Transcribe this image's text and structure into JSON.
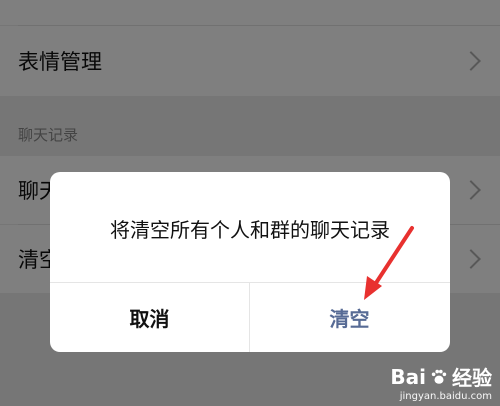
{
  "settings": {
    "sticker_label": "表情管理",
    "section_label": "聊天记录",
    "chat_row_partial": "聊天",
    "clear_row_partial": "清空"
  },
  "dialog": {
    "message": "将清空所有个人和群的聊天记录",
    "cancel_label": "取消",
    "confirm_label": "清空",
    "confirm_color": "#576b95"
  },
  "watermark": {
    "brand": "Bai",
    "brand_suffix": "经验",
    "url": "jingyan.baidu.com"
  },
  "annotation": {
    "arrow_color": "#e8312f",
    "icon": "red-arrow-icon"
  }
}
